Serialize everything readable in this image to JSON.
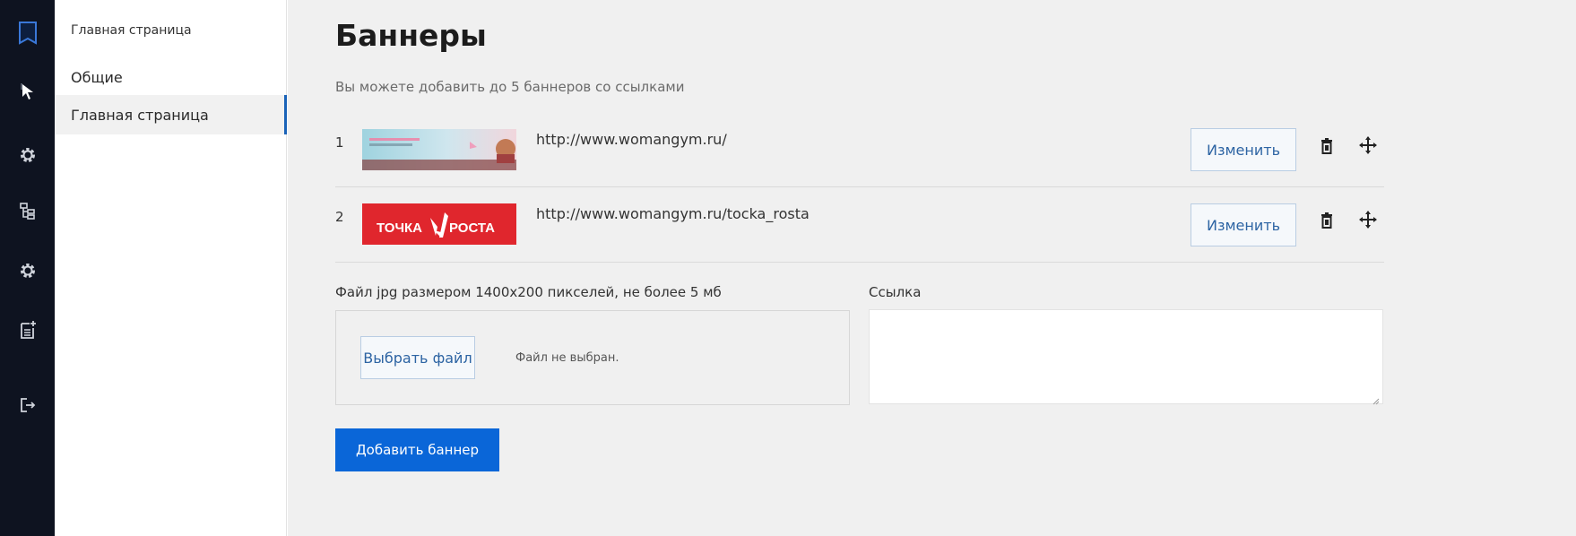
{
  "rail": {
    "icons": [
      "book-icon",
      "cursor-icon",
      "gear-icon",
      "tree-icon",
      "gear-icon",
      "add-document-icon",
      "logout-icon"
    ]
  },
  "nav": {
    "breadcrumb": "Главная страница",
    "items": [
      {
        "label": "Общие",
        "active": false
      },
      {
        "label": "Главная страница",
        "active": true
      }
    ]
  },
  "main": {
    "title": "Баннеры",
    "subtitle": "Вы можете добавить до 5 баннеров со ссылками",
    "banners": [
      {
        "index": "1",
        "url": "http://www.womangym.ru/",
        "edit_label": "Изменить"
      },
      {
        "index": "2",
        "url": "http://www.womangym.ru/tocka_rosta",
        "edit_label": "Изменить",
        "banner_text_left": "ТОЧКА",
        "banner_text_right": "РОСТА"
      }
    ],
    "form": {
      "file_label": "Файл jpg размером 1400x200 пикселей, не более 5 мб",
      "choose_file_label": "Выбрать файл",
      "no_file_text": "Файл не выбран.",
      "link_label": "Ссылка",
      "link_value": "",
      "add_button_label": "Добавить баннер"
    }
  },
  "colors": {
    "rail_bg": "#0e1320",
    "accent": "#0a66d8",
    "banner_red": "#e0262d"
  }
}
